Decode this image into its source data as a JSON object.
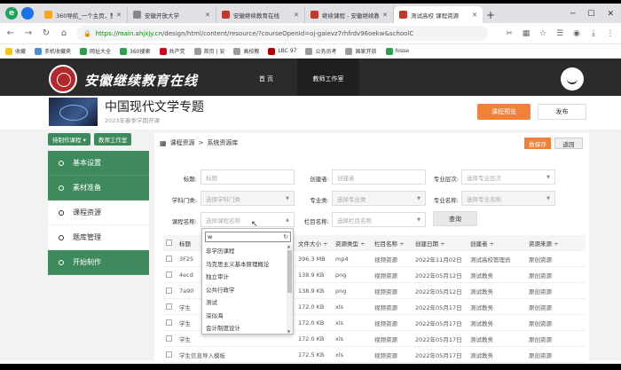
{
  "browser": {
    "tabs": [
      {
        "title": "360导航_一个主页，整",
        "color": "#f5a623",
        "active": false
      },
      {
        "title": "安徽开放大学",
        "color": "#888888",
        "active": false
      },
      {
        "title": "安徽继续教育在线",
        "color": "#c0392b",
        "active": false
      },
      {
        "title": "继续课程 - 安徽继续教",
        "color": "#c0392b",
        "active": false
      },
      {
        "title": "测试高校 课程资源",
        "color": "#c0392b",
        "active": true
      }
    ],
    "new_tab": "+",
    "url_host": "https://main.ahjxjy.cn",
    "url_path": "/design/html/content/resource/?courseOpenId=oj-gaievz7rhfrdv96oekw&schoolC",
    "bookmarks": [
      "收藏",
      "手机收藏夹",
      "网址大全",
      "360搜索",
      "共产党",
      "首页 | 安",
      "高校教",
      "LBC 97",
      "公务员考",
      "国家开放",
      "hisse"
    ]
  },
  "site": {
    "name": "安徽继续教育在线",
    "nav": [
      "首 页",
      "教师工作室"
    ],
    "nav_active": 1
  },
  "course": {
    "title": "中国现代文学专题",
    "subtitle": "2023年春季学期开课",
    "preview_btn": "课程预览",
    "publish_btn": "发布"
  },
  "sidebar": {
    "top_buttons": [
      "待制作课程 ▾",
      "教师工作室"
    ],
    "items": [
      {
        "label": "基本设置",
        "style": "green"
      },
      {
        "label": "素材准备",
        "style": "green"
      },
      {
        "label": "课程资源",
        "style": "light"
      },
      {
        "label": "题库管理",
        "style": "light"
      },
      {
        "label": "开始制作",
        "style": "green"
      }
    ]
  },
  "main": {
    "breadcrumb": [
      "课程资源",
      ">",
      "系统资源库"
    ],
    "save_btn": "数保存",
    "back_btn": "返回",
    "query_btn": "查询",
    "filters": {
      "title_label": "标题:",
      "title_ph": "标题",
      "creator_label": "创建者:",
      "creator_ph": "创建者",
      "level_label": "专业层次:",
      "level_ph": "选择专业层次",
      "category_label": "学科门类:",
      "category_ph": "选择学科门类",
      "major_type_label": "专业类:",
      "major_type_ph": "选择专业类",
      "major_name_label": "专业名称:",
      "major_name_ph": "选择专业名称",
      "course_label": "课程名称:",
      "course_ph": "选择课程名称",
      "column_label": "栏目名称:",
      "column_ph": "选择栏目名称"
    },
    "table": {
      "headers": [
        "标题",
        "文件大小 ÷",
        "资源类型 ÷",
        "栏目名称 ÷",
        "创建日期 ÷",
        "创建者 ÷",
        "资源来源 ÷"
      ],
      "rows": [
        [
          "3F25",
          "396.3 MB",
          "mp4",
          "视频资源",
          "2022年11月02日",
          "测试高校管理员",
          "原创资源"
        ],
        [
          "4ecd",
          "138.9 KB",
          "png",
          "视频资源",
          "2022年05月12日",
          "测试教务",
          "原创资源"
        ],
        [
          "7a90",
          "138.9 KB",
          "png",
          "视频资源",
          "2022年05月12日",
          "测试教务",
          "原创资源"
        ],
        [
          "学生",
          "172.0 KB",
          "xls",
          "视频资源",
          "2022年05月17日",
          "测试教务",
          "原创资源"
        ],
        [
          "学生",
          "172.0 KB",
          "xls",
          "视频资源",
          "2022年05月17日",
          "测试教务",
          "原创资源"
        ],
        [
          "学生",
          "172.0 KB",
          "xls",
          "视频资源",
          "2022年05月17日",
          "测试教务",
          "原创资源"
        ],
        [
          "学生信息导入模板",
          "172.5 KB",
          "xls",
          "视频资源",
          "2022年05月17日",
          "测试教务",
          "原创资源"
        ]
      ]
    }
  },
  "dropdown": {
    "search_value": "w",
    "options": [
      "非学历课程",
      "马克思主义基本原理概论",
      "独立审计",
      "公共行政学",
      "测试",
      "深似海",
      "会计制度设计"
    ]
  }
}
